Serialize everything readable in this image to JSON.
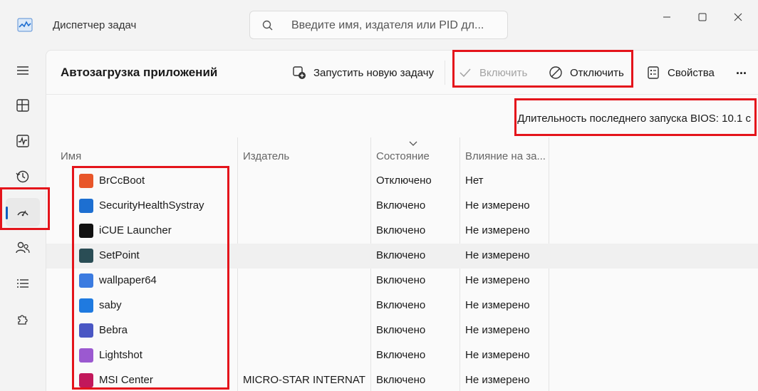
{
  "window": {
    "title": "Диспетчер задач",
    "search_placeholder": "Введите имя, издателя или PID дл..."
  },
  "sidebar": {
    "items": [
      {
        "name": "menu",
        "icon": "hamburger-icon"
      },
      {
        "name": "processes",
        "icon": "processes-icon"
      },
      {
        "name": "performance",
        "icon": "performance-icon"
      },
      {
        "name": "app-history",
        "icon": "history-icon"
      },
      {
        "name": "startup-apps",
        "icon": "speedometer-icon",
        "active": true
      },
      {
        "name": "users",
        "icon": "users-icon"
      },
      {
        "name": "details",
        "icon": "list-icon"
      },
      {
        "name": "services",
        "icon": "puzzle-icon"
      }
    ]
  },
  "toolbar": {
    "page_title": "Автозагрузка приложений",
    "new_task": "Запустить новую задачу",
    "enable": "Включить",
    "disable": "Отключить",
    "properties": "Свойства",
    "more": "..."
  },
  "bios_info": "Длительность последнего запуска BIOS: 10.1 с",
  "table": {
    "columns": [
      "Имя",
      "Издатель",
      "Состояние",
      "Влияние на за..."
    ],
    "rows": [
      {
        "name": "BrCcBoot",
        "publisher": "",
        "status": "Отключено",
        "impact": "Нет",
        "icon_color": "#e8562a"
      },
      {
        "name": "SecurityHealthSystray",
        "publisher": "",
        "status": "Включено",
        "impact": "Не измерено",
        "icon_color": "#1d6fd1"
      },
      {
        "name": "iCUE Launcher",
        "publisher": "",
        "status": "Включено",
        "impact": "Не измерено",
        "icon_color": "#111111"
      },
      {
        "name": "SetPoint",
        "publisher": "",
        "status": "Включено",
        "impact": "Не измерено",
        "icon_color": "#2a4d55"
      },
      {
        "name": "wallpaper64",
        "publisher": "",
        "status": "Включено",
        "impact": "Не измерено",
        "icon_color": "#3b7be0"
      },
      {
        "name": "saby",
        "publisher": "",
        "status": "Включено",
        "impact": "Не измерено",
        "icon_color": "#1f7ae0"
      },
      {
        "name": "Bebra",
        "publisher": "",
        "status": "Включено",
        "impact": "Не измерено",
        "icon_color": "#4a57c4"
      },
      {
        "name": "Lightshot",
        "publisher": "",
        "status": "Включено",
        "impact": "Не измерено",
        "icon_color": "#9b59d0"
      },
      {
        "name": "MSI Center",
        "publisher": "MICRO-STAR INTERNATI...",
        "status": "Включено",
        "impact": "Не измерено",
        "icon_color": "#c2185b"
      }
    ],
    "highlighted_row": 3
  },
  "colors": {
    "accent": "#0f5cbf",
    "annotation": "#e4141b"
  }
}
